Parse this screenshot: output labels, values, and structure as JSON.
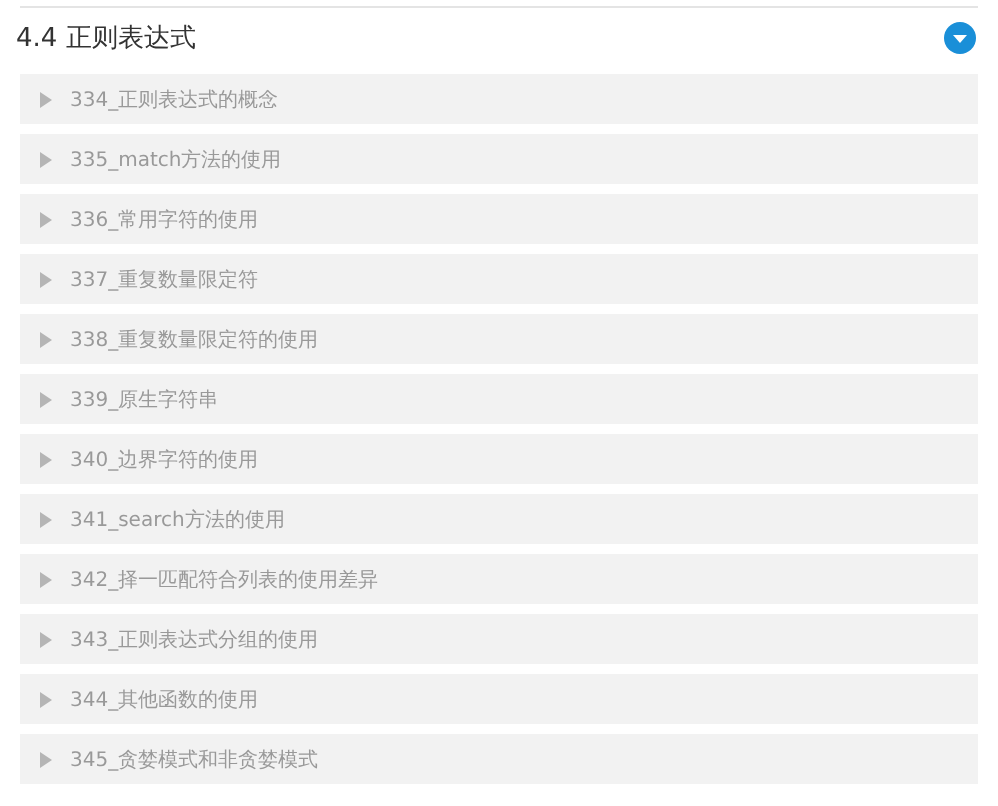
{
  "section": {
    "title": "4.4 正则表达式",
    "expanded": true,
    "lessons": [
      {
        "title": "334_正则表达式的概念"
      },
      {
        "title": "335_match方法的使用"
      },
      {
        "title": "336_常用字符的使用"
      },
      {
        "title": "337_重复数量限定符"
      },
      {
        "title": "338_重复数量限定符的使用"
      },
      {
        "title": "339_原生字符串"
      },
      {
        "title": "340_边界字符的使用"
      },
      {
        "title": "341_search方法的使用"
      },
      {
        "title": "342_择一匹配符合列表的使用差异"
      },
      {
        "title": "343_正则表达式分组的使用"
      },
      {
        "title": "344_其他函数的使用"
      },
      {
        "title": "345_贪婪模式和非贪婪模式"
      }
    ]
  }
}
